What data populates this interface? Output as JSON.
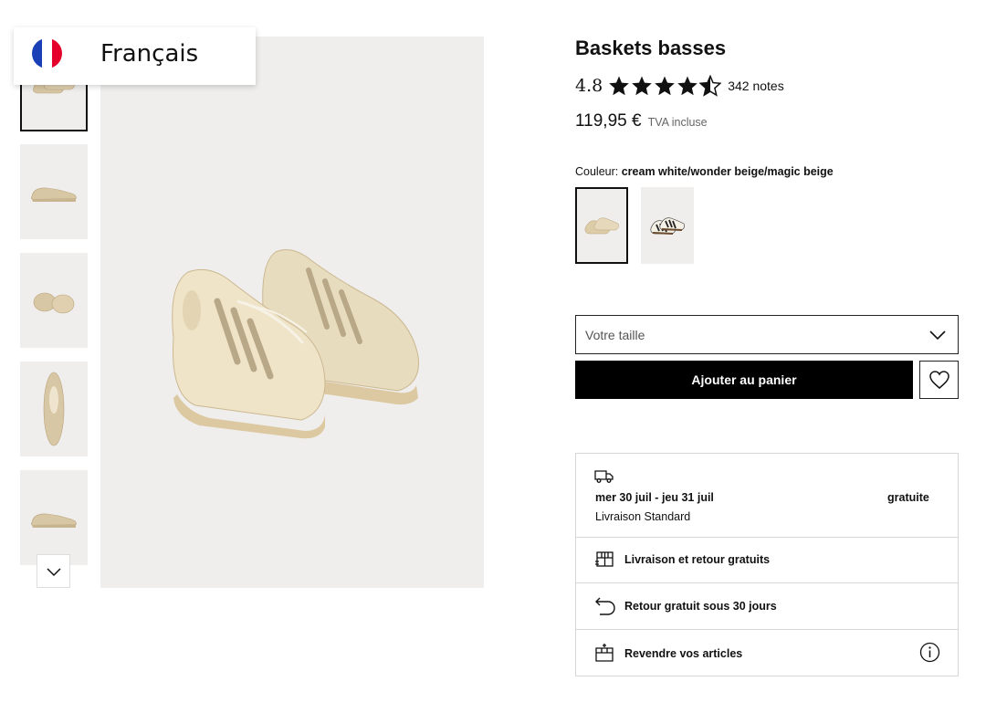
{
  "language": {
    "label": "Français",
    "flag_colors": [
      "#1a3fb6",
      "#ffffff",
      "#e4002b"
    ]
  },
  "product": {
    "title": "Baskets basses",
    "rating": {
      "value": "4.8",
      "stars": 4.5,
      "max_stars": 5,
      "count": "342 notes"
    },
    "price": {
      "value": "119,95 €",
      "tax_note": "TVA incluse"
    },
    "color": {
      "label": "Couleur:",
      "value": "cream white/wonder beige/magic beige"
    }
  },
  "gallery": {
    "thumbnails": [
      "shoe-pair-icon",
      "shoe-side-icon",
      "shoe-back-icon",
      "shoe-top-icon",
      "shoe-side-icon"
    ],
    "selected_thumbnail": 1,
    "scroll_icon": "chevron-down-icon"
  },
  "swatches": [
    {
      "name": "cream-beige",
      "selected": true
    },
    {
      "name": "black-white",
      "selected": false
    }
  ],
  "size_select": {
    "placeholder": "Votre taille"
  },
  "cart_button": {
    "label": "Ajouter au panier"
  },
  "delivery": {
    "date": "mer 30 juil - jeu 31 juil",
    "price": "gratuite",
    "method": "Livraison Standard",
    "rows": [
      {
        "label": "Livraison et retour gratuits",
        "icon": "package-icon"
      },
      {
        "label": "Retour gratuit sous 30 jours",
        "icon": "return-arrow-icon"
      },
      {
        "label": "Revendre vos articles",
        "icon": "resell-box-icon"
      }
    ]
  },
  "colors": {
    "accent_black": "#000000",
    "image_bg": "#efeeec",
    "border": "#d6d6d6"
  }
}
